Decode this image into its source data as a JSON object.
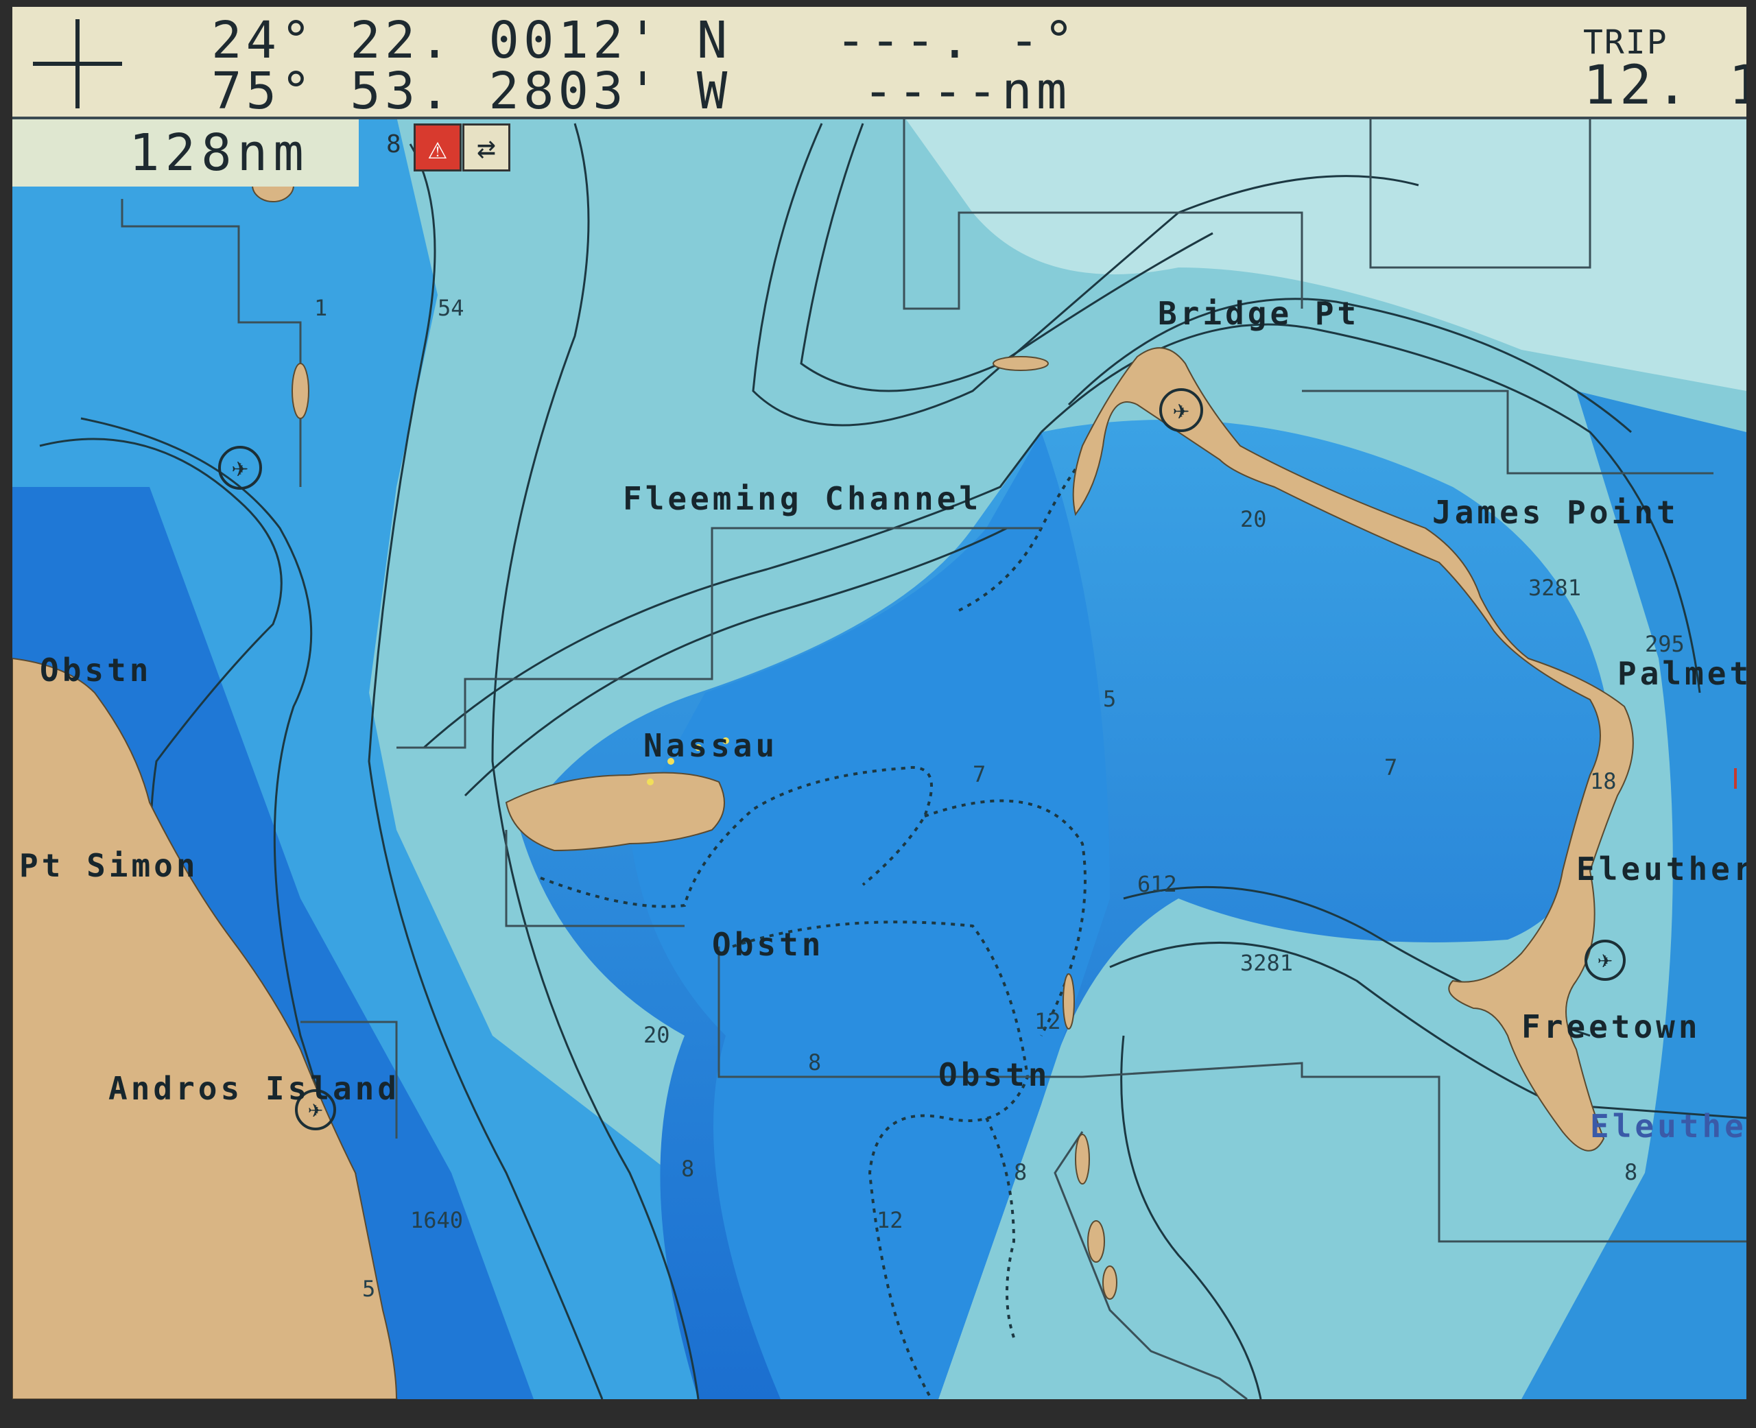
{
  "header": {
    "latitude": "24° 22. 0012' N",
    "longitude": "75° 53. 2803' W",
    "course": "---. -°",
    "distance": "----nm",
    "trip_label": "TRIP",
    "trip_value": "12. 1"
  },
  "range": {
    "value": "128nm",
    "small_marker": "8"
  },
  "icons": [
    "alarm-icon",
    "route-icon",
    "cursor-crosshair-icon",
    "airport-icon"
  ],
  "colors": {
    "land": "#d9b584",
    "deep_water": "#1f7fd6",
    "shallow_water": "#7fc7d6",
    "header_bg": "#e9e4c8"
  },
  "map": {
    "place_labels": [
      "Bridge Pt",
      "Fleeming Channel",
      "James Point",
      "Obstn",
      "Palmet",
      "Nassau",
      "Pt Simon",
      "Eleuther",
      "Obstn",
      "Obstn",
      "Andros Island",
      "Freetown",
      "Eleuthe"
    ],
    "depth_labels": [
      "54",
      "1",
      "20",
      "3281",
      "295",
      "5",
      "7",
      "7",
      "18",
      "612",
      "3281",
      "20",
      "8",
      "12",
      "8",
      "12",
      "1640",
      "5",
      "8",
      "8"
    ]
  }
}
